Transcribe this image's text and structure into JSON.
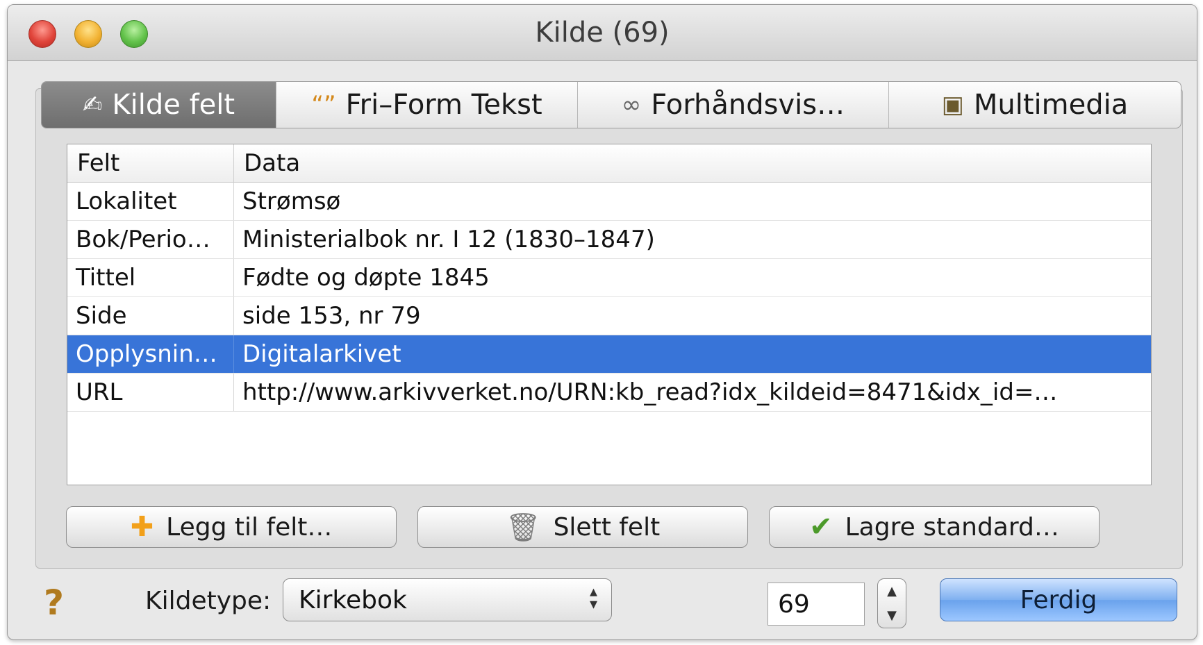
{
  "window": {
    "title": "Kilde (69)"
  },
  "tabs": [
    {
      "label": "Kilde felt",
      "icon": "pencil-icon",
      "active": true
    },
    {
      "label": "Fri–Form Tekst",
      "icon": "quotes-icon",
      "active": false
    },
    {
      "label": "Forhåndsvis…",
      "icon": "glasses-icon",
      "active": false
    },
    {
      "label": "Multimedia",
      "icon": "photo-icon",
      "active": false
    }
  ],
  "table": {
    "headers": {
      "field": "Felt",
      "data": "Data"
    },
    "rows": [
      {
        "field": "Lokalitet",
        "data": "Strømsø"
      },
      {
        "field": "Bok/Perio…",
        "data": "Ministerialbok nr. I 12 (1830–1847)"
      },
      {
        "field": "Tittel",
        "data": "Fødte og døpte 1845"
      },
      {
        "field": "Side",
        "data": "side 153, nr 79"
      },
      {
        "field": "Opplysnin…",
        "data": "Digitalarkivet",
        "selected": true
      },
      {
        "field": "URL",
        "data": "http://www.arkivverket.no/URN:kb_read?idx_kildeid=8471&idx_id=…"
      }
    ]
  },
  "buttons": {
    "add_field": "Legg til felt…",
    "delete_field": "Slett felt",
    "save_default": "Lagre standard…",
    "done": "Ferdig"
  },
  "footer": {
    "help": "?",
    "source_type_label": "Kildetype:",
    "source_type_value": "Kirkebok",
    "number_value": "69"
  },
  "colors": {
    "selection": "#3874d8",
    "active_tab": "#7a7a7a",
    "default_button": "#7fb0f0"
  }
}
